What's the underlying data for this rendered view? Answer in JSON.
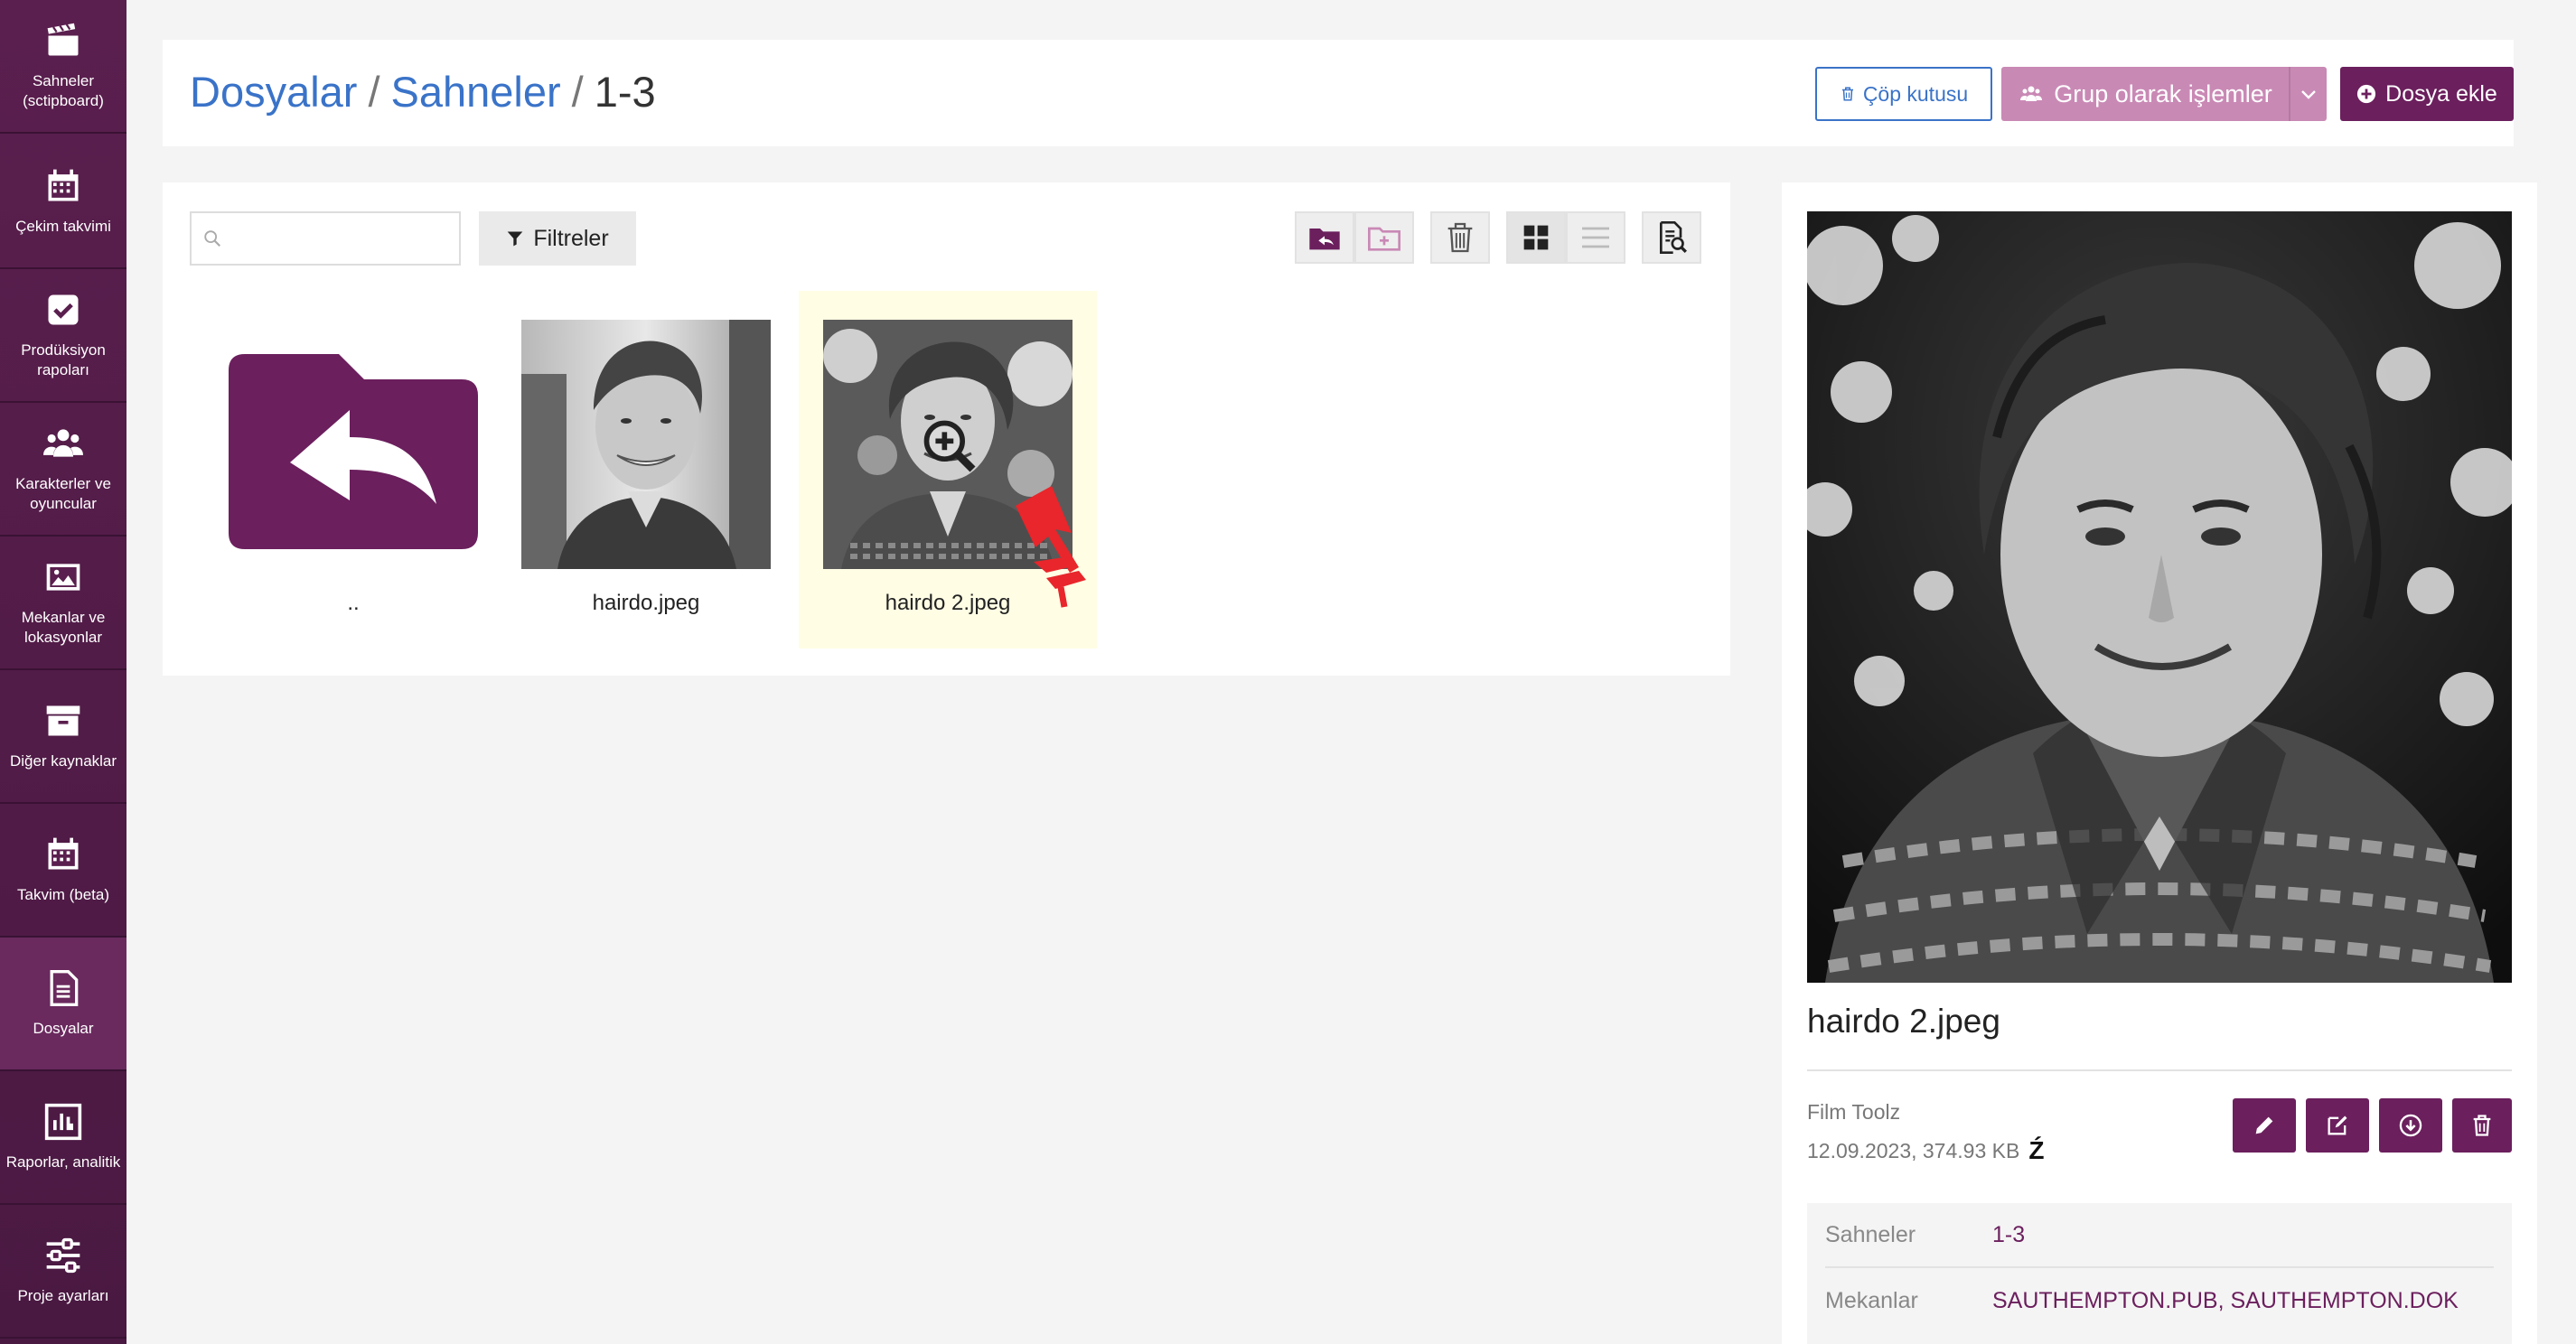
{
  "sidebar": {
    "items": [
      {
        "label": "Sahneler (sctipboard)",
        "icon": "clapperboard-icon"
      },
      {
        "label": "Çekim takvimi",
        "icon": "calendar-icon"
      },
      {
        "label": "Prodüksiyon rapoları",
        "icon": "check-square-icon"
      },
      {
        "label": "Karakterler ve oyuncular",
        "icon": "users-icon"
      },
      {
        "label": "Mekanlar ve lokasyonlar",
        "icon": "image-icon"
      },
      {
        "label": "Diğer kaynaklar",
        "icon": "archive-icon"
      },
      {
        "label": "Takvim (beta)",
        "icon": "calendar-icon"
      },
      {
        "label": "Dosyalar",
        "icon": "file-icon"
      },
      {
        "label": "Raporlar, analitik",
        "icon": "bar-chart-icon"
      },
      {
        "label": "Proje ayarları",
        "icon": "sliders-icon"
      }
    ]
  },
  "header": {
    "breadcrumb": [
      {
        "label": "Dosyalar"
      },
      {
        "label": "Sahneler"
      },
      {
        "label": "1-3"
      }
    ],
    "separator": "/",
    "trash_label": "Çöp kutusu",
    "group_label": "Grup olarak işlemler",
    "add_label": "Dosya ekle"
  },
  "files": {
    "search_placeholder": "",
    "search_value": "",
    "filter_label": "Filtreler",
    "items": [
      {
        "name": "..",
        "type": "parent-folder"
      },
      {
        "name": "hairdo.jpeg",
        "type": "image"
      },
      {
        "name": "hairdo 2.jpeg",
        "type": "image",
        "selected": true
      }
    ]
  },
  "detail": {
    "file_name": "hairdo 2.jpeg",
    "owner": "Film Toolz",
    "meta": "12.09.2023, 374.93 KB",
    "meta_icon": "Ź",
    "properties": [
      {
        "key": "Sahneler",
        "value": "1-3"
      },
      {
        "key": "Mekanlar",
        "value": "SAUTHEMPTON.PUB, SAUTHEMPTON.DOK"
      }
    ]
  },
  "colors": {
    "brand": "#6b1f5d",
    "brand_light": "#c989b5",
    "link": "#3a73c8",
    "selected_bg": "#fffde4"
  }
}
